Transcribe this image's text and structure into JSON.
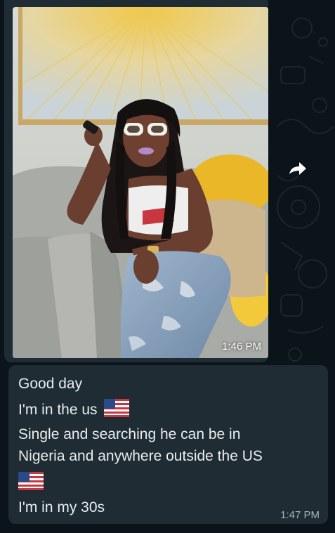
{
  "chat": {
    "photo_message": {
      "time": "1:46 PM",
      "image_alt": "Photo of a woman with long dark hair, white sunglasses and ripped jeans seated on a grey sofa with yellow pillows, holding a remote"
    },
    "forward_icon": "forward-arrow-icon",
    "text_message": {
      "lines": [
        "Good  day",
        "I'm in the us",
        "Single and searching he can be in",
        "Nigeria and anywhere outside the US",
        "I'm in my 30s"
      ],
      "time": "1:47 PM"
    }
  },
  "colors": {
    "background": "#0b141a",
    "bubble": "#1f2c33",
    "text": "#e9edef",
    "time": "#a7b2b9"
  }
}
